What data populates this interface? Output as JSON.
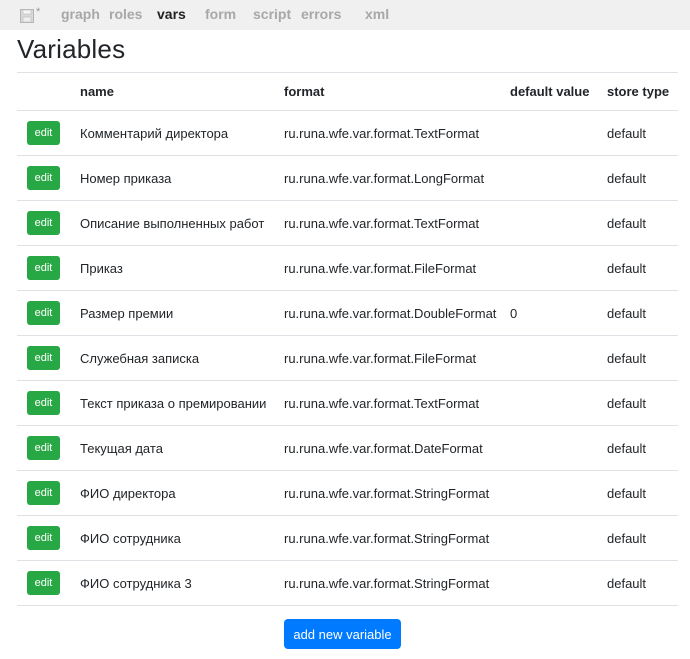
{
  "topbar": {
    "modified_marker": "*",
    "tabs": [
      {
        "label": "graph",
        "active": false
      },
      {
        "label": "roles",
        "active": false
      },
      {
        "label": "vars",
        "active": true
      },
      {
        "label": "form",
        "active": false
      },
      {
        "label": "script",
        "active": false
      },
      {
        "label": "errors",
        "active": false
      },
      {
        "label": "xml",
        "active": false
      }
    ]
  },
  "page": {
    "title": "Variables"
  },
  "table": {
    "headers": {
      "name": "name",
      "format": "format",
      "default_value": "default value",
      "store_type": "store type"
    },
    "edit_label": "edit",
    "rows": [
      {
        "name": "Комментарий директора",
        "format": "ru.runa.wfe.var.format.TextFormat",
        "default_value": "",
        "store_type": "default"
      },
      {
        "name": "Номер приказа",
        "format": "ru.runa.wfe.var.format.LongFormat",
        "default_value": "",
        "store_type": "default"
      },
      {
        "name": "Описание выполненных работ",
        "format": "ru.runa.wfe.var.format.TextFormat",
        "default_value": "",
        "store_type": "default"
      },
      {
        "name": "Приказ",
        "format": "ru.runa.wfe.var.format.FileFormat",
        "default_value": "",
        "store_type": "default"
      },
      {
        "name": "Размер премии",
        "format": "ru.runa.wfe.var.format.DoubleFormat",
        "default_value": "0",
        "store_type": "default"
      },
      {
        "name": "Служебная записка",
        "format": "ru.runa.wfe.var.format.FileFormat",
        "default_value": "",
        "store_type": "default"
      },
      {
        "name": "Текст приказа о премировании",
        "format": "ru.runa.wfe.var.format.TextFormat",
        "default_value": "",
        "store_type": "default"
      },
      {
        "name": "Текущая дата",
        "format": "ru.runa.wfe.var.format.DateFormat",
        "default_value": "",
        "store_type": "default"
      },
      {
        "name": "ФИО директора",
        "format": "ru.runa.wfe.var.format.StringFormat",
        "default_value": "",
        "store_type": "default"
      },
      {
        "name": "ФИО сотрудника",
        "format": "ru.runa.wfe.var.format.StringFormat",
        "default_value": "",
        "store_type": "default"
      },
      {
        "name": "ФИО сотрудника 3",
        "format": "ru.runa.wfe.var.format.StringFormat",
        "default_value": "",
        "store_type": "default"
      }
    ]
  },
  "actions": {
    "add_label": "add new variable"
  },
  "colors": {
    "edit_button": "#28a745",
    "add_button": "#007bff",
    "topbar_bg": "#f0f0f0",
    "inactive_tab": "#a8a8a8"
  },
  "icons": {
    "save": "floppy-disk-icon"
  }
}
